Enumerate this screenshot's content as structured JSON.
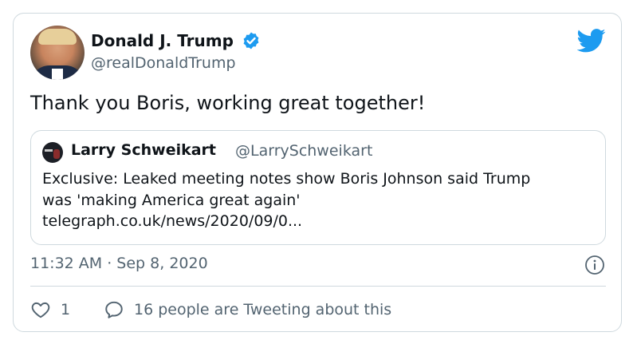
{
  "tweet": {
    "author": {
      "name": "Donald J. Trump",
      "handle": "@realDonaldTrump",
      "verified": true
    },
    "text": "Thank you Boris, working great together!",
    "quoted": {
      "author_name": "Larry Schweikart",
      "author_handle": "@LarrySchweikart",
      "lines": [
        "Exclusive: Leaked meeting notes show Boris Johnson said Trump",
        "was 'making America great again'",
        "telegraph.co.uk/news/2020/09/0..."
      ]
    },
    "timestamp": "11:32 AM · Sep 8, 2020",
    "likes": "1",
    "tweeting_text": "16 people are Tweeting about this"
  },
  "icons": {
    "logo": "twitter-bird-icon",
    "verified": "verified-badge-icon",
    "info": "info-icon",
    "like": "heart-icon",
    "reply": "reply-bubble-icon"
  },
  "colors": {
    "brand": "#1d9bf0",
    "text": "#0f1419",
    "secondary": "#536471",
    "border": "#cfd9de"
  }
}
